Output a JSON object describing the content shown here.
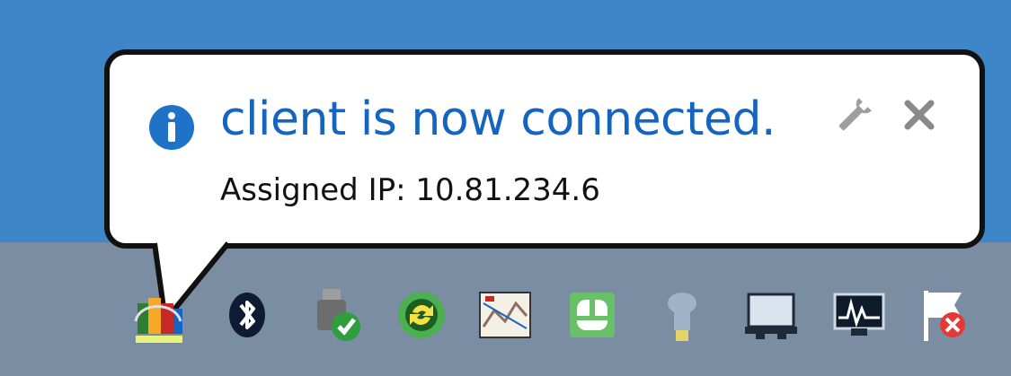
{
  "notification": {
    "title": "client is now connected.",
    "message": "Assigned IP: 10.81.234.6"
  },
  "colors": {
    "desktop": "#3f86c8",
    "taskbar": "#7b8da2",
    "title_text": "#1565c0",
    "info_icon": "#1e73c9"
  },
  "tray": {
    "icons": [
      "vpn-client-icon",
      "bluetooth-icon",
      "usb-safely-remove-icon",
      "sync-icon",
      "network-map-icon",
      "green-app-icon",
      "lightbulb-icon",
      "display-icon",
      "monitor-activity-icon",
      "action-center-flag-icon"
    ]
  }
}
